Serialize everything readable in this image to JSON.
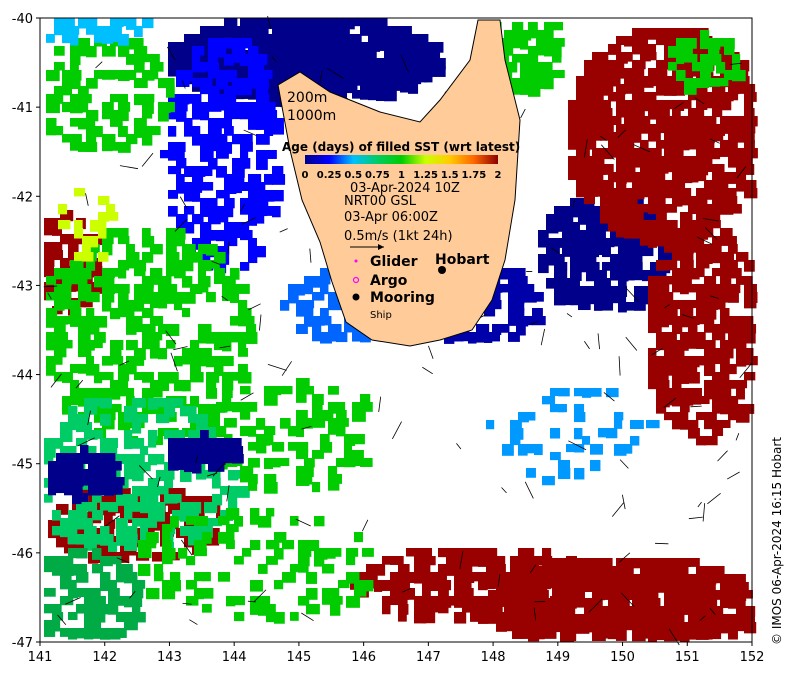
{
  "map": {
    "x_ticks": [
      "141",
      "142",
      "143",
      "144",
      "145",
      "146",
      "147",
      "148",
      "149",
      "150",
      "151",
      "152"
    ],
    "y_ticks": [
      "-40",
      "-41",
      "-42",
      "-43",
      "-44",
      "-45",
      "-46",
      "-47"
    ],
    "x_range": [
      141,
      152
    ],
    "y_range": [
      -47,
      -40
    ],
    "land_color": "#ffcc99",
    "depth_labels": [
      "200m",
      "1000m"
    ]
  },
  "legend": {
    "colorbar_title": "Age (days) of filled SST (wrt latest)",
    "colorbar_ticks": [
      "0",
      "0.25",
      "0.5",
      "0.75",
      "1",
      "1.25",
      "1.5",
      "1.75",
      "2"
    ],
    "colorbar_colors": [
      "#00008b",
      "#0000ff",
      "#00bfff",
      "#00cc66",
      "#00cc00",
      "#ccff00",
      "#ffcc00",
      "#ff6600",
      "#8b0000"
    ],
    "sst_time": "03-Apr-2024 10Z",
    "current_source": "NRT00 GSL",
    "current_time": "03-Apr 06:00Z",
    "vector_scale": "0.5m/s (1kt 24h)",
    "markers": [
      {
        "label": "Glider",
        "symbol": "dot",
        "color": "#ff00ff"
      },
      {
        "label": "Argo",
        "symbol": "circle",
        "color": "#ff00ff"
      },
      {
        "label": "Mooring",
        "symbol": "dot",
        "color": "#000000"
      },
      {
        "label": "Ship",
        "symbol": "none",
        "color": "#000000"
      }
    ],
    "place_label": "Hobart"
  },
  "credit": "© IMOS 06-Apr-2024 16:15 Hobart"
}
